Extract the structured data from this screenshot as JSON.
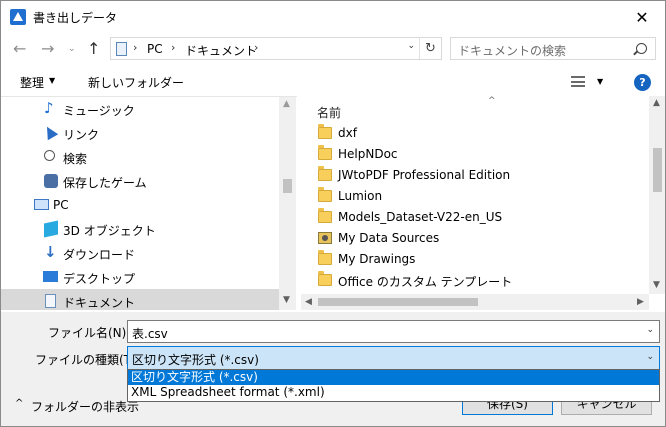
{
  "window": {
    "title": "書き出しデータ",
    "close": "✕"
  },
  "address": {
    "crumbs": [
      "PC",
      "ドキュメント"
    ],
    "separator": "›",
    "search_placeholder": "ドキュメントの検索"
  },
  "nav_buttons": {
    "back": "←",
    "forward": "→",
    "recent": "⌄",
    "up": "↑",
    "refresh": "↻",
    "address_dropdown": "⌄"
  },
  "toolbar": {
    "organize": "整理",
    "new_folder": "新しいフォルダー",
    "help": "?",
    "caret": "▼"
  },
  "nav_pane": {
    "items": [
      {
        "label": "ミュージック",
        "icon": "music-icon"
      },
      {
        "label": "リンク",
        "icon": "link-icon"
      },
      {
        "label": "検索",
        "icon": "search-icon"
      },
      {
        "label": "保存したゲーム",
        "icon": "saved-games-icon"
      },
      {
        "label": "PC",
        "icon": "pc-icon"
      },
      {
        "label": "3D オブジェクト",
        "icon": "3d-objects-icon"
      },
      {
        "label": "ダウンロード",
        "icon": "download-icon"
      },
      {
        "label": "デスクトップ",
        "icon": "desktop-icon"
      },
      {
        "label": "ドキュメント",
        "icon": "documents-icon",
        "selected": true
      }
    ]
  },
  "file_pane": {
    "column_header": "名前",
    "sort_caret": "^",
    "files": [
      {
        "name": "dxf",
        "icon": "folder-icon"
      },
      {
        "name": "HelpNDoc",
        "icon": "folder-icon"
      },
      {
        "name": "JWtoPDF Professional Edition",
        "icon": "folder-icon"
      },
      {
        "name": "Lumion",
        "icon": "folder-icon"
      },
      {
        "name": "Models_Dataset-V22-en_US",
        "icon": "folder-icon"
      },
      {
        "name": "My Data Sources",
        "icon": "data-sources-icon"
      },
      {
        "name": "My Drawings",
        "icon": "folder-icon"
      },
      {
        "name": "Office のカスタム テンプレート",
        "icon": "folder-icon"
      }
    ]
  },
  "scroll_arrows": {
    "up": "▲",
    "down": "▼",
    "left": "◀",
    "right": "▶"
  },
  "bottom": {
    "filename_label": "ファイル名(N):",
    "filename_value": "表.csv",
    "filetype_label": "ファイルの種類(T):",
    "filetype_value": "区切り文字形式 (*.csv)",
    "dropdown_caret": "⌄",
    "filetype_options": [
      "区切り文字形式 (*.csv)",
      "XML Spreadsheet format (*.xml)"
    ],
    "hide_folders": "フォルダーの非表示",
    "hide_folders_caret": "^",
    "save_button": "保存(S)",
    "cancel_button": "キャンセル"
  },
  "colors": {
    "selection_blue": "#0078d7",
    "select_highlight": "#cce4f7",
    "nav_selected": "#d9d9d9",
    "folder_yellow": "#f7cf5a",
    "help_blue": "#1565c0"
  }
}
